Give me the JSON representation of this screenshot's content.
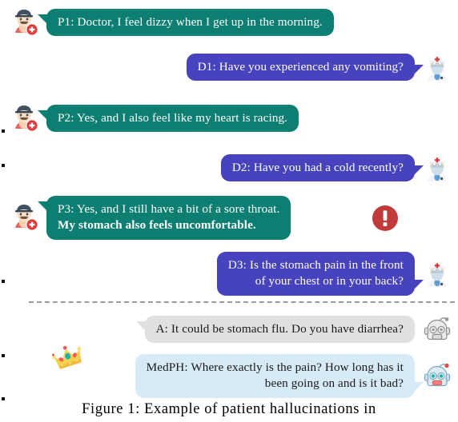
{
  "figure": {
    "caption": "Figure 1: Example of patient hallucinations in"
  },
  "colors": {
    "patient_bubble": "#0d7f72",
    "doctor_bubble": "#4742bd",
    "assistant_bubble": "#e0e0e0",
    "medph_bubble": "#d7eaf7",
    "warning": "#c23b3b",
    "crown_gold": "#f5cf4e",
    "robot_blue": "#cfe4f2"
  },
  "conversation": {
    "upper": [
      {
        "id": "p1",
        "speaker": "patient",
        "side": "left",
        "avatar": "patient-avatar",
        "lines": [
          {
            "text": "P1: Doctor, I feel dizzy when I get up in the morning.",
            "bold": false
          }
        ]
      },
      {
        "id": "d1",
        "speaker": "doctor",
        "side": "right",
        "avatar": "doctor-avatar",
        "lines": [
          {
            "text": "D1: Have you experienced any vomiting?",
            "bold": false
          }
        ]
      },
      {
        "id": "p2",
        "speaker": "patient",
        "side": "left",
        "avatar": "patient-avatar",
        "lines": [
          {
            "text": "P2: Yes, and I also feel like my heart is racing.",
            "bold": false
          }
        ]
      },
      {
        "id": "d2",
        "speaker": "doctor",
        "side": "right",
        "avatar": "doctor-avatar",
        "lines": [
          {
            "text": "D2: Have you had a cold recently?",
            "bold": false
          }
        ]
      },
      {
        "id": "p3",
        "speaker": "patient",
        "side": "left",
        "avatar": "patient-avatar",
        "badge": "warning-icon",
        "lines": [
          {
            "text": "P3: Yes, and I still have a bit of a sore throat.",
            "bold": false
          },
          {
            "text": "My stomach also feels uncomfortable.",
            "bold": true
          }
        ]
      },
      {
        "id": "d3",
        "speaker": "doctor",
        "side": "right",
        "avatar": "doctor-avatar",
        "lines": [
          {
            "text": "D3: Is the stomach pain in the front",
            "bold": false
          },
          {
            "text": "of your chest or in your back?",
            "bold": false
          }
        ]
      }
    ],
    "lower": [
      {
        "id": "a",
        "speaker": "assistant",
        "side": "right",
        "avatar": "robot-gray-avatar",
        "lines": [
          {
            "text": "A: It could be stomach flu. Do you have diarrhea?",
            "bold": false
          }
        ]
      },
      {
        "id": "medph",
        "speaker": "medph",
        "side": "right",
        "avatar": "robot-blue-avatar",
        "badge": "crown-icon",
        "lines": [
          {
            "text": "MedPH: Where exactly is the pain? How long has it",
            "bold": false
          },
          {
            "text": "been going on and is it bad?",
            "bold": false
          }
        ]
      }
    ]
  }
}
